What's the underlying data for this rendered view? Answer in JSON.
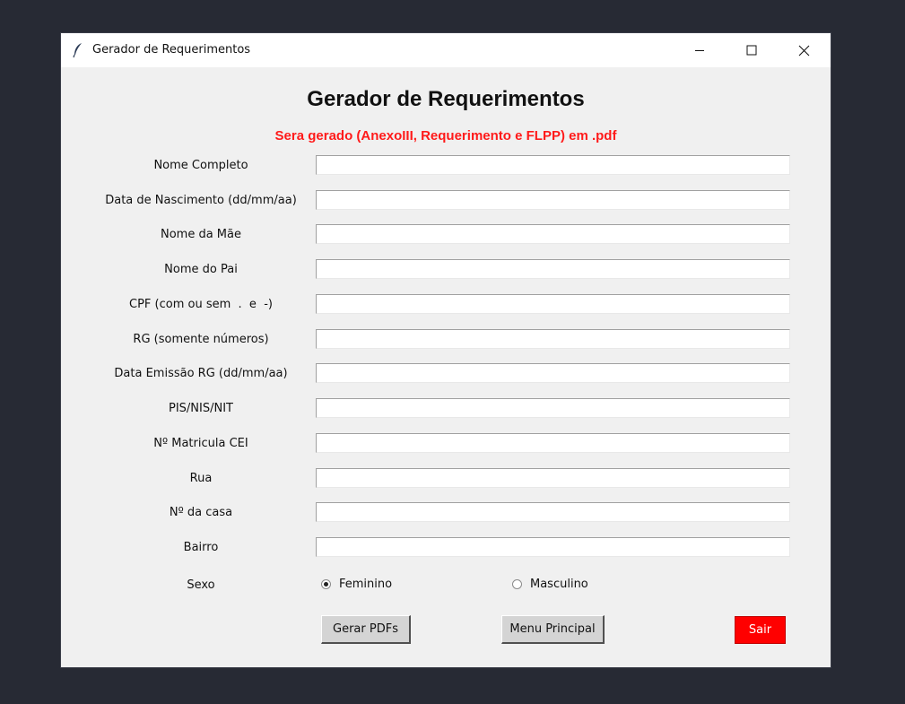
{
  "window": {
    "title": "Gerador de Requerimentos"
  },
  "header": {
    "title": "Gerador de Requerimentos",
    "subtitle": "Sera gerado (AnexoIII, Requerimento e FLPP) em .pdf"
  },
  "fields": [
    {
      "label": "Nome Completo",
      "value": ""
    },
    {
      "label": "Data de Nascimento (dd/mm/aa)",
      "value": ""
    },
    {
      "label": "Nome da Mãe",
      "value": ""
    },
    {
      "label": "Nome do Pai",
      "value": ""
    },
    {
      "label": "CPF (com ou sem  .  e  -)",
      "value": ""
    },
    {
      "label": "RG (somente números)",
      "value": ""
    },
    {
      "label": "Data Emissão RG (dd/mm/aa)",
      "value": ""
    },
    {
      "label": "PIS/NIS/NIT",
      "value": ""
    },
    {
      "label": "Nº Matricula CEI",
      "value": ""
    },
    {
      "label": "Rua",
      "value": ""
    },
    {
      "label": "Nº da casa",
      "value": ""
    },
    {
      "label": "Bairro",
      "value": ""
    }
  ],
  "sexo": {
    "label": "Sexo",
    "options": [
      {
        "label": "Feminino",
        "selected": true
      },
      {
        "label": "Masculino",
        "selected": false
      }
    ]
  },
  "buttons": {
    "gerar": "Gerar PDFs",
    "menu": "Menu Principal",
    "sair": "Sair"
  },
  "colors": {
    "desktop": "#272a34",
    "window_bg": "#f0f0f0",
    "subtitle": "#ff1a1a",
    "exit_button": "#ff0000"
  }
}
